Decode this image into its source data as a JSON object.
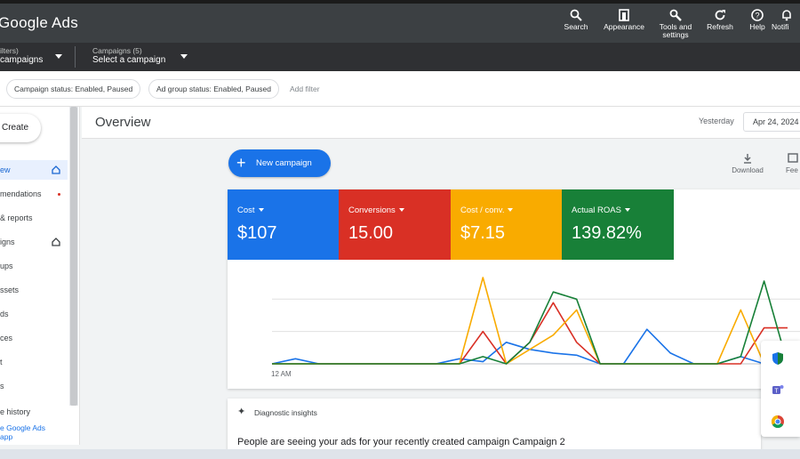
{
  "app": {
    "title": "Google Ads"
  },
  "topbar": {
    "tools": [
      {
        "label": "Search",
        "icon": "search-icon"
      },
      {
        "label": "Appearance",
        "icon": "appearance-icon"
      },
      {
        "label": "Tools and settings",
        "icon": "wrench-icon"
      },
      {
        "label": "Refresh",
        "icon": "refresh-icon"
      },
      {
        "label": "Help",
        "icon": "help-icon"
      },
      {
        "label": "Notifi",
        "icon": "bell-icon"
      }
    ]
  },
  "selectors": {
    "filters": {
      "sub": "ilters)",
      "main": "campaigns"
    },
    "campaigns": {
      "sub": "Campaigns (5)",
      "main": "Select a campaign"
    }
  },
  "filters": {
    "chips": [
      "Campaign status: Enabled, Paused",
      "Ad group status: Enabled, Paused"
    ],
    "add_filter": "Add filter"
  },
  "sidebar": {
    "create_label": "Create",
    "items": [
      {
        "label": "ew"
      },
      {
        "label": "mendations"
      },
      {
        "label": "& reports"
      },
      {
        "label": "igns"
      },
      {
        "label": "ups"
      },
      {
        "label": "ssets"
      },
      {
        "label": "ds"
      },
      {
        "label": "ces"
      },
      {
        "label": "t"
      },
      {
        "label": "s"
      },
      {
        "label": "e history"
      }
    ],
    "get_app_line1": "e Google Ads",
    "get_app_line2": "app"
  },
  "overview": {
    "title": "Overview",
    "date_prefix": "Yesterday",
    "date_value": "Apr 24, 2024"
  },
  "actions": {
    "new_campaign": "New campaign",
    "download": "Download",
    "feedback": "Fee"
  },
  "metrics": [
    {
      "label": "Cost",
      "value": "$107",
      "color": "#1a73e8"
    },
    {
      "label": "Conversions",
      "value": "15.00",
      "color": "#d93025"
    },
    {
      "label": "Cost / conv.",
      "value": "$7.15",
      "color": "#f9ab00"
    },
    {
      "label": "Actual ROAS",
      "value": "139.82%",
      "color": "#188038"
    }
  ],
  "chart_data": {
    "type": "line",
    "x": [
      0,
      1,
      2,
      3,
      4,
      5,
      6,
      7,
      8,
      9,
      10,
      11,
      12,
      13,
      14,
      15,
      16,
      17,
      18,
      19,
      20,
      21,
      22
    ],
    "xlabel_first": "12 AM",
    "series": [
      {
        "color": "#1a73e8",
        "values": [
          0,
          0.07,
          0,
          0,
          0,
          0,
          0,
          0,
          0.07,
          0.03,
          0.3,
          0.2,
          0.15,
          0.12,
          0,
          0,
          0.48,
          0.15,
          0,
          0,
          0.1,
          0,
          0
        ]
      },
      {
        "color": "#d93025",
        "values": [
          0,
          0,
          0,
          0,
          0,
          0,
          0,
          0,
          0,
          0.45,
          0,
          0.3,
          0.85,
          0.3,
          0,
          0,
          0,
          0,
          0,
          0,
          0,
          0.5,
          0.5
        ]
      },
      {
        "color": "#f9ab00",
        "values": [
          0,
          0,
          0,
          0,
          0,
          0,
          0,
          0,
          0,
          1.2,
          0,
          0.2,
          0.4,
          0.75,
          0,
          0,
          0,
          0,
          0,
          0,
          0.75,
          0,
          0
        ]
      },
      {
        "color": "#188038",
        "values": [
          0,
          0,
          0,
          0,
          0,
          0,
          0,
          0,
          0,
          0.1,
          0,
          0.3,
          1.0,
          0.9,
          0,
          0,
          0,
          0,
          0,
          0,
          0.1,
          1.15,
          0
        ]
      }
    ]
  },
  "diagnostic": {
    "title": "Diagnostic insights",
    "message": "People are seeing your ads for your recently created campaign Campaign 2"
  }
}
